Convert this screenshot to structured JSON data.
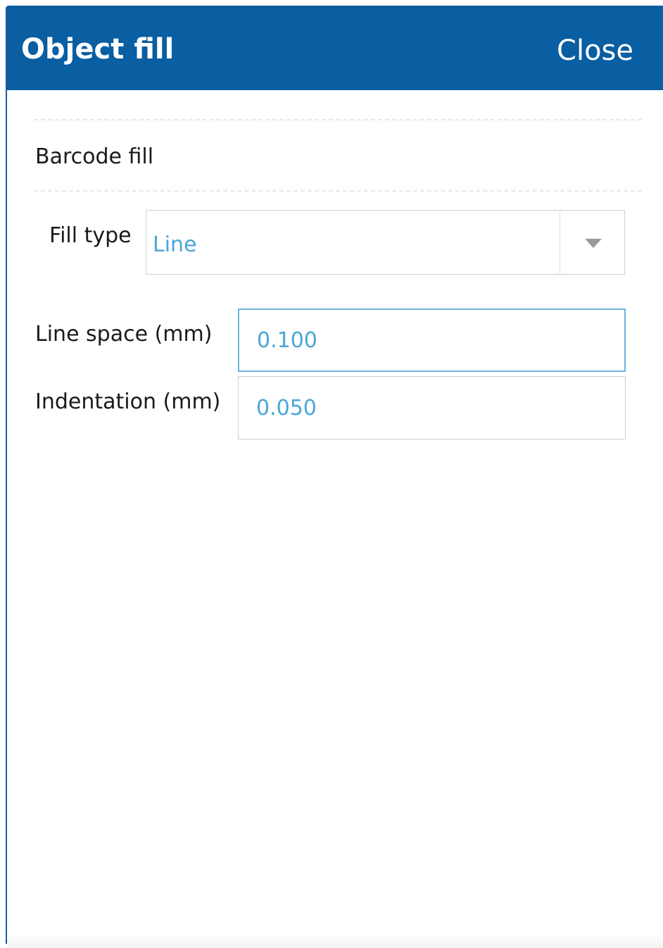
{
  "header": {
    "title": "Object fill",
    "close_label": "Close",
    "background_color": "#0a5ea2"
  },
  "section": {
    "label": "Barcode fill"
  },
  "fill_type": {
    "label": "Fill type",
    "selected": "Line",
    "arrow_icon": "chevron-down-icon"
  },
  "line_space": {
    "label": "Line space (mm)",
    "value": "0.100"
  },
  "indentation": {
    "label": "Indentation (mm)",
    "value": "0.050"
  },
  "colors": {
    "value_text": "#4aa6d6",
    "focus_border": "#6cb3d9"
  }
}
